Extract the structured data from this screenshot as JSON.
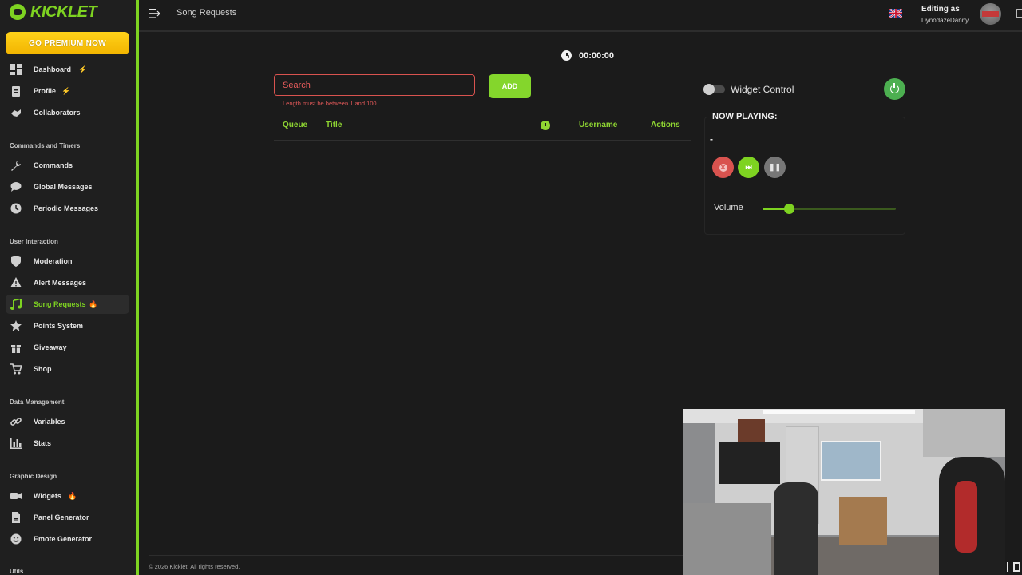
{
  "brand": {
    "name": "KICKLET",
    "accent_color": "#7ed321"
  },
  "premium": {
    "label": "GO PREMIUM NOW"
  },
  "sidebar": {
    "items_top": [
      {
        "label": "Dashboard",
        "icon": "dashboard-icon",
        "badge": "bolt"
      },
      {
        "label": "Profile",
        "icon": "clipboard-icon",
        "badge": "bolt"
      },
      {
        "label": "Collaborators",
        "icon": "handshake-icon"
      }
    ],
    "section_commands": "Commands and Timers",
    "items_commands": [
      {
        "label": "Commands",
        "icon": "wrench-icon"
      },
      {
        "label": "Global Messages",
        "icon": "chat-bubble-icon"
      },
      {
        "label": "Periodic Messages",
        "icon": "clock-icon"
      }
    ],
    "section_interaction": "User Interaction",
    "items_interaction": [
      {
        "label": "Moderation",
        "icon": "shield-icon"
      },
      {
        "label": "Alert Messages",
        "icon": "warning-icon"
      },
      {
        "label": "Song Requests",
        "icon": "music-note-icon",
        "badge": "fire",
        "active": true
      },
      {
        "label": "Points System",
        "icon": "star-icon"
      },
      {
        "label": "Giveaway",
        "icon": "gift-icon"
      },
      {
        "label": "Shop",
        "icon": "cart-icon"
      }
    ],
    "section_data": "Data Management",
    "items_data": [
      {
        "label": "Variables",
        "icon": "link-icon"
      },
      {
        "label": "Stats",
        "icon": "bar-chart-icon"
      }
    ],
    "section_graphic": "Graphic Design",
    "items_graphic": [
      {
        "label": "Widgets",
        "icon": "video-icon",
        "badge": "fire"
      },
      {
        "label": "Panel Generator",
        "icon": "document-icon"
      },
      {
        "label": "Emote Generator",
        "icon": "smiley-icon"
      }
    ],
    "section_utils": "Utils"
  },
  "topbar": {
    "page_title": "Song Requests",
    "editing_as": "Editing as",
    "username": "DynodazeDanny"
  },
  "timer": {
    "value": "00:00:00"
  },
  "search": {
    "placeholder": "Search",
    "value": "",
    "error": "Length must be between 1 and 100"
  },
  "add_button": {
    "label": "ADD"
  },
  "table": {
    "columns": {
      "queue": "Queue",
      "title": "Title",
      "username": "Username",
      "actions": "Actions"
    },
    "rows": []
  },
  "widget_control": {
    "label": "Widget Control",
    "enabled": false
  },
  "now_playing": {
    "title": "NOW PLAYING:",
    "track": "-"
  },
  "volume": {
    "label": "Volume",
    "value": 0.2
  },
  "footer": {
    "text": "© 2026 Kicklet. All rights reserved."
  }
}
